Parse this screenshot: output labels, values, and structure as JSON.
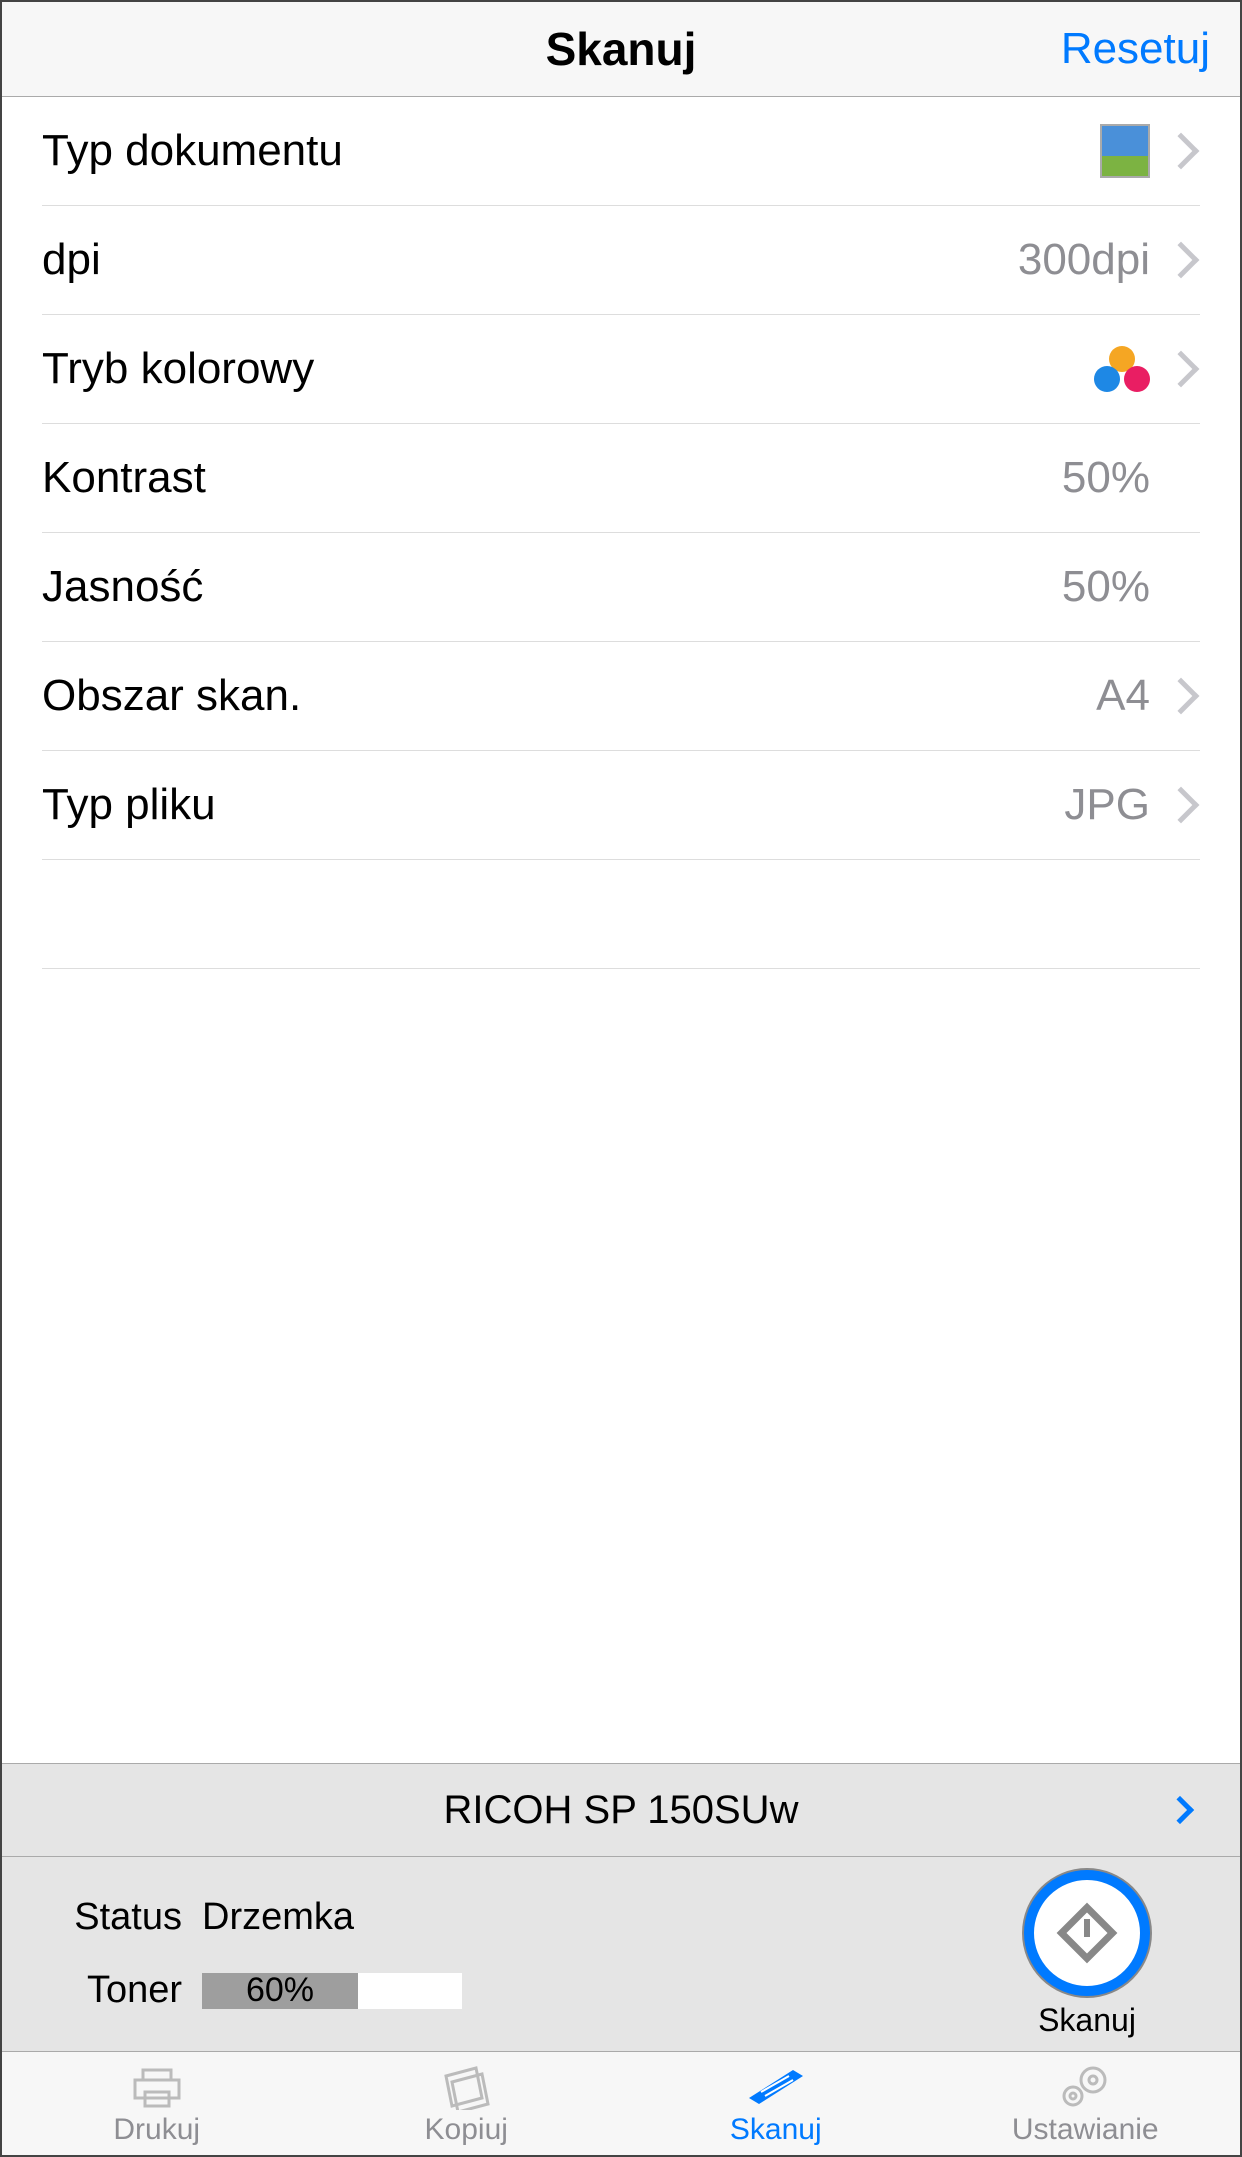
{
  "header": {
    "title": "Skanuj",
    "reset": "Resetuj"
  },
  "settings": {
    "doc_type": {
      "label": "Typ dokumentu"
    },
    "dpi": {
      "label": "dpi",
      "value": "300dpi"
    },
    "color_mode": {
      "label": "Tryb kolorowy"
    },
    "contrast": {
      "label": "Kontrast",
      "value": "50%"
    },
    "brightness": {
      "label": "Jasność",
      "value": "50%"
    },
    "scan_area": {
      "label": "Obszar skan.",
      "value": "A4"
    },
    "file_type": {
      "label": "Typ pliku",
      "value": "JPG"
    }
  },
  "printer": {
    "name": "RICOH SP 150SUw"
  },
  "status": {
    "status_label": "Status",
    "status_value": "Drzemka",
    "toner_label": "Toner",
    "toner_value": "60%",
    "toner_percent": 60
  },
  "scan_button": {
    "label": "Skanuj"
  },
  "tabs": {
    "print": "Drukuj",
    "copy": "Kopiuj",
    "scan": "Skanuj",
    "settings": "Ustawianie"
  }
}
